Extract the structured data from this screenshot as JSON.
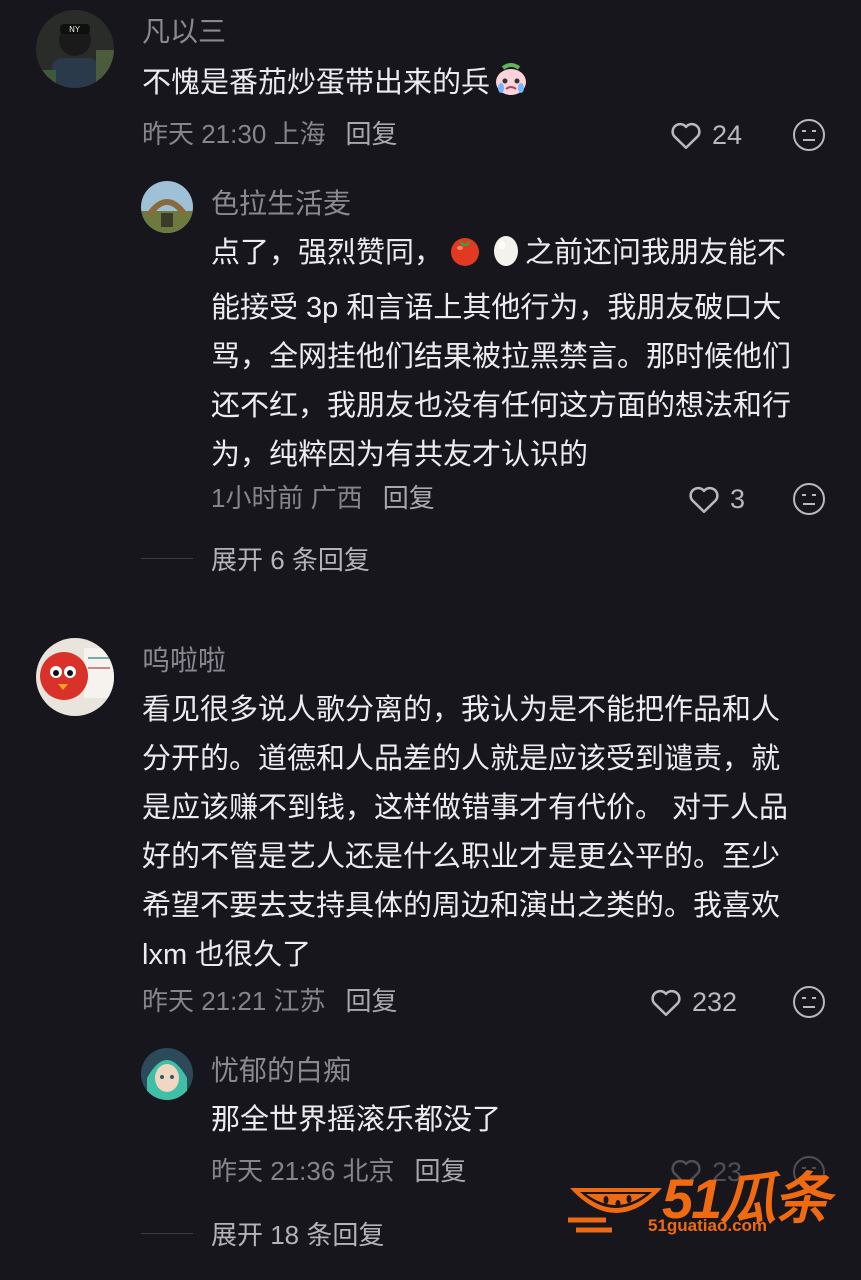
{
  "comments": [
    {
      "username": "凡以三",
      "text": "不愧是番茄炒蛋带出来的兵",
      "time": "昨天 21:30 上海",
      "reply_label": "回复",
      "likes": "24",
      "replies": [
        {
          "username": "色拉生活麦",
          "lines": [
            "点了，强烈赞同，",
            "能接受 3p 和言语上其他行为，我朋友破口大",
            "骂，全网挂他们结果被拉黑禁言。那时候他们",
            "还不红，我朋友也没有任何这方面的想法和行",
            "为，纯粹因为有共友才认识的"
          ],
          "line1_tail": "之前还问我朋友能不",
          "time": "1小时前 广西",
          "reply_label": "回复",
          "likes": "3"
        }
      ],
      "expand_label": "展开 6 条回复"
    },
    {
      "username": "呜啦啦",
      "lines": [
        "看见很多说人歌分离的，我认为是不能把作品和人",
        "分开的。道德和人品差的人就是应该受到谴责，就",
        "是应该赚不到钱，这样做错事才有代价。 对于人品",
        "好的不管是艺人还是什么职业才是更公平的。至少",
        "希望不要去支持具体的周边和演出之类的。我喜欢",
        "lxm 也很久了"
      ],
      "time": "昨天 21:21 江苏",
      "reply_label": "回复",
      "likes": "232",
      "replies": [
        {
          "username": "忧郁的白痴",
          "text": "那全世界摇滚乐都没了",
          "time": "昨天 21:36 北京",
          "reply_label": "回复",
          "likes": "23"
        }
      ],
      "expand_label": "展开 18 条回复"
    }
  ],
  "watermark": {
    "brand": "51瓜条",
    "url": "51guatiao.com"
  },
  "colors": {
    "background": "#17161c",
    "text": "#ececef",
    "muted": "#86858c",
    "watermark": "#f06a12"
  }
}
